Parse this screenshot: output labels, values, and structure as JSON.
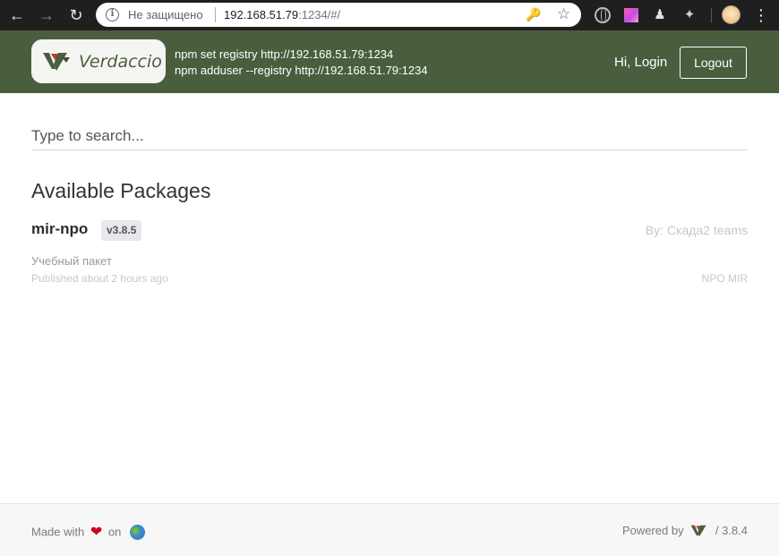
{
  "browser": {
    "security_label": "Не защищено",
    "url_host": "192.168.51.79",
    "url_rest": ":1234/#/"
  },
  "header": {
    "logo_text": "Verdaccio",
    "commands": [
      "npm set registry http://192.168.51.79:1234",
      "npm adduser --registry http://192.168.51.79:1234"
    ],
    "greeting": "Hi, Login",
    "logout_label": "Logout",
    "brand_color": "#4a5e3e"
  },
  "search": {
    "placeholder": "Type to search..."
  },
  "main": {
    "section_title": "Available Packages",
    "packages": [
      {
        "name": "mir-npo",
        "version": "v3.8.5",
        "author": "By: Скада2 teams",
        "description": "Учебный пакет",
        "published": "Published about 2 hours ago",
        "license": "NPO MIR"
      }
    ]
  },
  "footer": {
    "made_with": "Made with",
    "on": "on",
    "powered_by": "Powered by",
    "version": "/ 3.8.4"
  }
}
